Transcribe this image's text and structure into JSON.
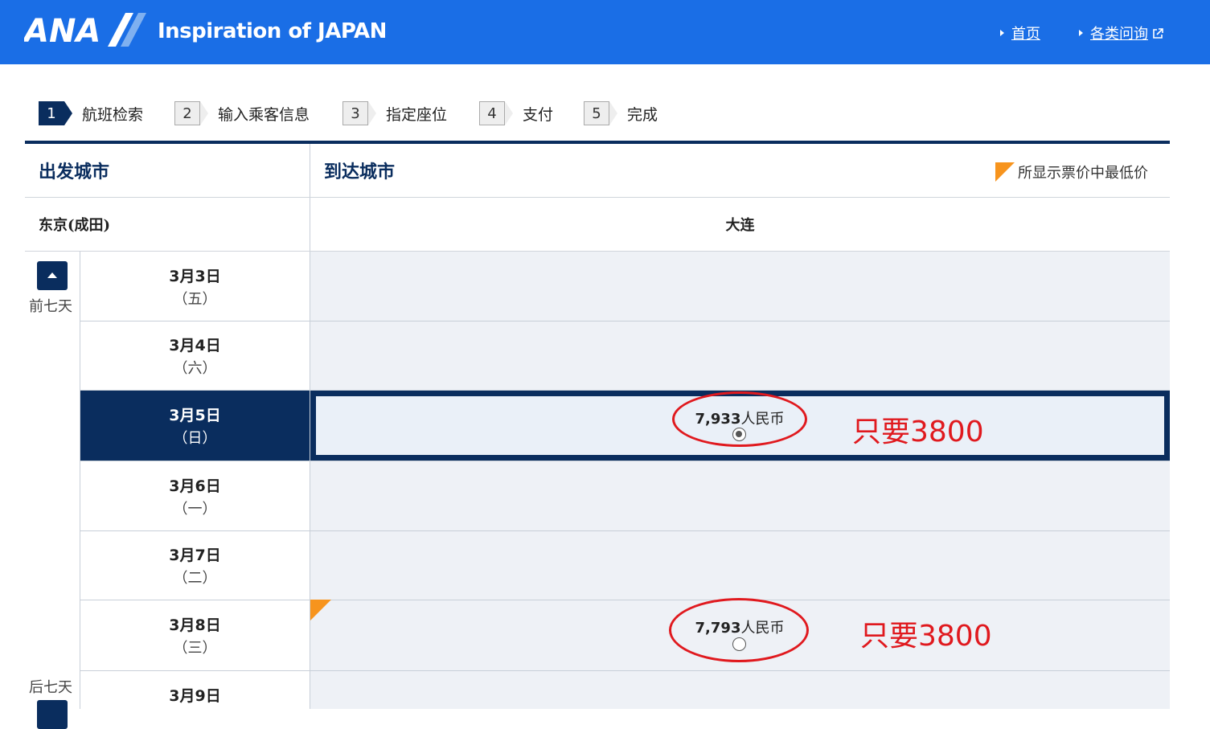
{
  "header": {
    "brand": "ANA",
    "tagline": "Inspiration of JAPAN",
    "links": [
      "首页",
      "各类问询"
    ],
    "colors": {
      "bar": "#1a6ee6",
      "navy": "#0a2d5e",
      "accent": "#f7941d",
      "annotation": "#e0191e"
    }
  },
  "steps": [
    {
      "num": "1",
      "label": "航班检索",
      "active": true
    },
    {
      "num": "2",
      "label": "输入乘客信息",
      "active": false
    },
    {
      "num": "3",
      "label": "指定座位",
      "active": false
    },
    {
      "num": "4",
      "label": "支付",
      "active": false
    },
    {
      "num": "5",
      "label": "完成",
      "active": false
    }
  ],
  "table": {
    "origin_header": "出发城市",
    "destination_header": "到达城市",
    "legend": "所显示票价中最低价",
    "origin_city": "东京(成田)",
    "destination_city": "大连",
    "prev_week": "前七天",
    "next_week": "后七天",
    "rows": [
      {
        "date": "3月3日",
        "weekday": "（五）",
        "price": "",
        "selected": false
      },
      {
        "date": "3月4日",
        "weekday": "（六）",
        "price": "",
        "selected": false
      },
      {
        "date": "3月5日",
        "weekday": "（日）",
        "price": "7,933",
        "currency": "人民币",
        "selected": true
      },
      {
        "date": "3月6日",
        "weekday": "（一）",
        "price": "",
        "selected": false
      },
      {
        "date": "3月7日",
        "weekday": "（二）",
        "price": "",
        "selected": false
      },
      {
        "date": "3月8日",
        "weekday": "（三）",
        "price": "7,793",
        "currency": "人民币",
        "selected": false,
        "lowest": true
      },
      {
        "date": "3月9日",
        "weekday": "",
        "price": "",
        "selected": false
      }
    ]
  },
  "annotations": [
    "只要3800",
    "只要3800"
  ]
}
